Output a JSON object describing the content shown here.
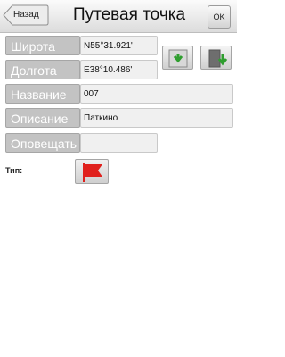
{
  "header": {
    "back_label": "Назад",
    "title": "Путевая точка",
    "ok_label": "OK"
  },
  "form": {
    "latitude": {
      "label": "Широта",
      "value": "N55°31.921'"
    },
    "longitude": {
      "label": "Долгота",
      "value": "E38°10.486'"
    },
    "name": {
      "label": "Название",
      "value": "007"
    },
    "description": {
      "label": "Описание",
      "value": "Паткино"
    },
    "alert": {
      "label": "Оповещать",
      "value": ""
    },
    "type": {
      "label": "Тип:",
      "icon": "red-flag-icon"
    }
  },
  "buttons": {
    "from_gps_icon": "download-green-arrow-icon",
    "to_gps_icon": "upload-green-arrow-icon"
  },
  "colors": {
    "label_bg": "#c3c3c3",
    "field_bg": "#f0f0f0",
    "arrow_green": "#2f9e2f",
    "flag_red": "#e0201c"
  }
}
